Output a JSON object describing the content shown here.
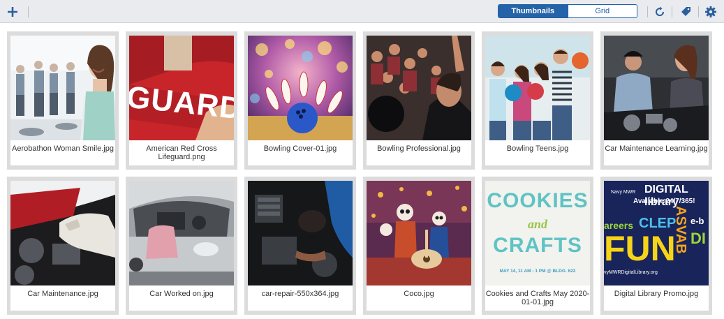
{
  "toolbar": {
    "add_icon": "plus-icon",
    "view_modes": [
      {
        "label": "Thumbnails",
        "active": true
      },
      {
        "label": "Grid",
        "active": false
      }
    ],
    "right_icons": [
      "refresh-icon",
      "tag-icon",
      "gear-icon"
    ],
    "accent_color": "#2563a8"
  },
  "gallery": {
    "items": [
      {
        "caption": "Aerobathon Woman Smile.jpg"
      },
      {
        "caption": "American Red Cross Lifeguard.png"
      },
      {
        "caption": "Bowling Cover-01.jpg"
      },
      {
        "caption": "Bowling Professional.jpg"
      },
      {
        "caption": "Bowling Teens.jpg"
      },
      {
        "caption": "Car Maintenance Learning.jpg"
      },
      {
        "caption": "Car Maintenance.jpg"
      },
      {
        "caption": "Car Worked on.jpg"
      },
      {
        "caption": "car-repair-550x364.jpg"
      },
      {
        "caption": "Coco.jpg"
      },
      {
        "caption": "Cookies and Crafts May 2020-01-01.jpg"
      },
      {
        "caption": "Digital Library Promo.jpg"
      }
    ]
  },
  "thumbnails": {
    "lifeguard_text": "GUARD",
    "cookies_line1": "COOKIES",
    "cookies_line2": "and",
    "cookies_line3": "CRAFTS",
    "cookies_date": "MAY 14, 11 AM - 1 PM @ BLDG. 622",
    "library_line1": "Navy MWR",
    "library_line2": "DIGITAL library",
    "library_line3": "Available 24/7/365!",
    "library_careers": "areers",
    "library_clep": "CLEP",
    "library_fun": "FUN",
    "library_asvab": "ASVAB",
    "library_eb": "e-b",
    "library_di": "DI",
    "library_url": "vyMWRDigitalLibrary.org"
  }
}
